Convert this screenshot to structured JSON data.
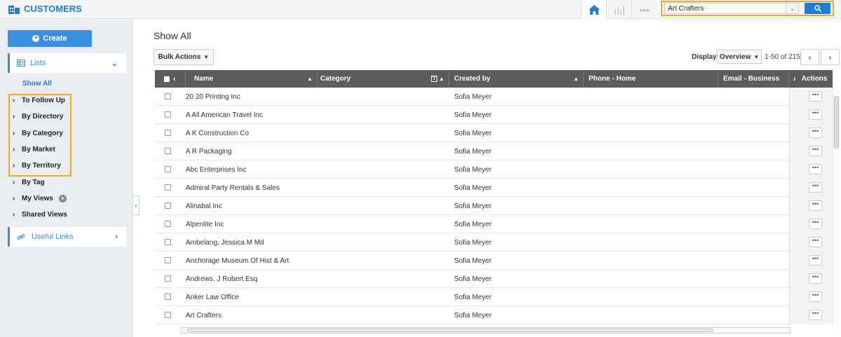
{
  "app": {
    "title": "CUSTOMERS"
  },
  "search": {
    "value": "Art Crafters"
  },
  "sidebar": {
    "create_label": "Create",
    "lists_label": "Lists",
    "show_all": "Show All",
    "items": [
      {
        "label": "To Follow Up"
      },
      {
        "label": "By Directory"
      },
      {
        "label": "By Category"
      },
      {
        "label": "By Market"
      },
      {
        "label": "By Territory"
      },
      {
        "label": "By Tag"
      },
      {
        "label": "My Views"
      },
      {
        "label": "Shared Views"
      }
    ],
    "useful_links": "Useful Links"
  },
  "main": {
    "title": "Show All",
    "bulk_actions": "Bulk Actions",
    "display_label": "Display",
    "display_value": "Overview",
    "pager": "1-50 of 215"
  },
  "table": {
    "columns": {
      "name": "Name",
      "category": "Category",
      "created_by": "Created by",
      "phone_home": "Phone - Home",
      "email_business": "Email - Business",
      "actions": "Actions"
    },
    "rows": [
      {
        "name": "20 20 Printing Inc",
        "created_by": "Sofia Meyer"
      },
      {
        "name": "A All American Travel Inc",
        "created_by": "Sofia Meyer"
      },
      {
        "name": "A K Construction Co",
        "created_by": "Sofia Meyer"
      },
      {
        "name": "A R Packaging",
        "created_by": "Sofia Meyer"
      },
      {
        "name": "Abc Enterprises Inc",
        "created_by": "Sofia Meyer"
      },
      {
        "name": "Admiral Party Rentals & Sales",
        "created_by": "Sofia Meyer"
      },
      {
        "name": "Alinabal Inc",
        "created_by": "Sofia Meyer"
      },
      {
        "name": "Alpenlite Inc",
        "created_by": "Sofia Meyer"
      },
      {
        "name": "Ambelang, Jessica M Md",
        "created_by": "Sofia Meyer"
      },
      {
        "name": "Anchorage Museum Of Hist & Art",
        "created_by": "Sofia Meyer"
      },
      {
        "name": "Andrews, J Robert Esq",
        "created_by": "Sofia Meyer"
      },
      {
        "name": "Anker Law Office",
        "created_by": "Sofia Meyer"
      },
      {
        "name": "Art Crafters",
        "created_by": "Sofia Meyer"
      }
    ]
  }
}
